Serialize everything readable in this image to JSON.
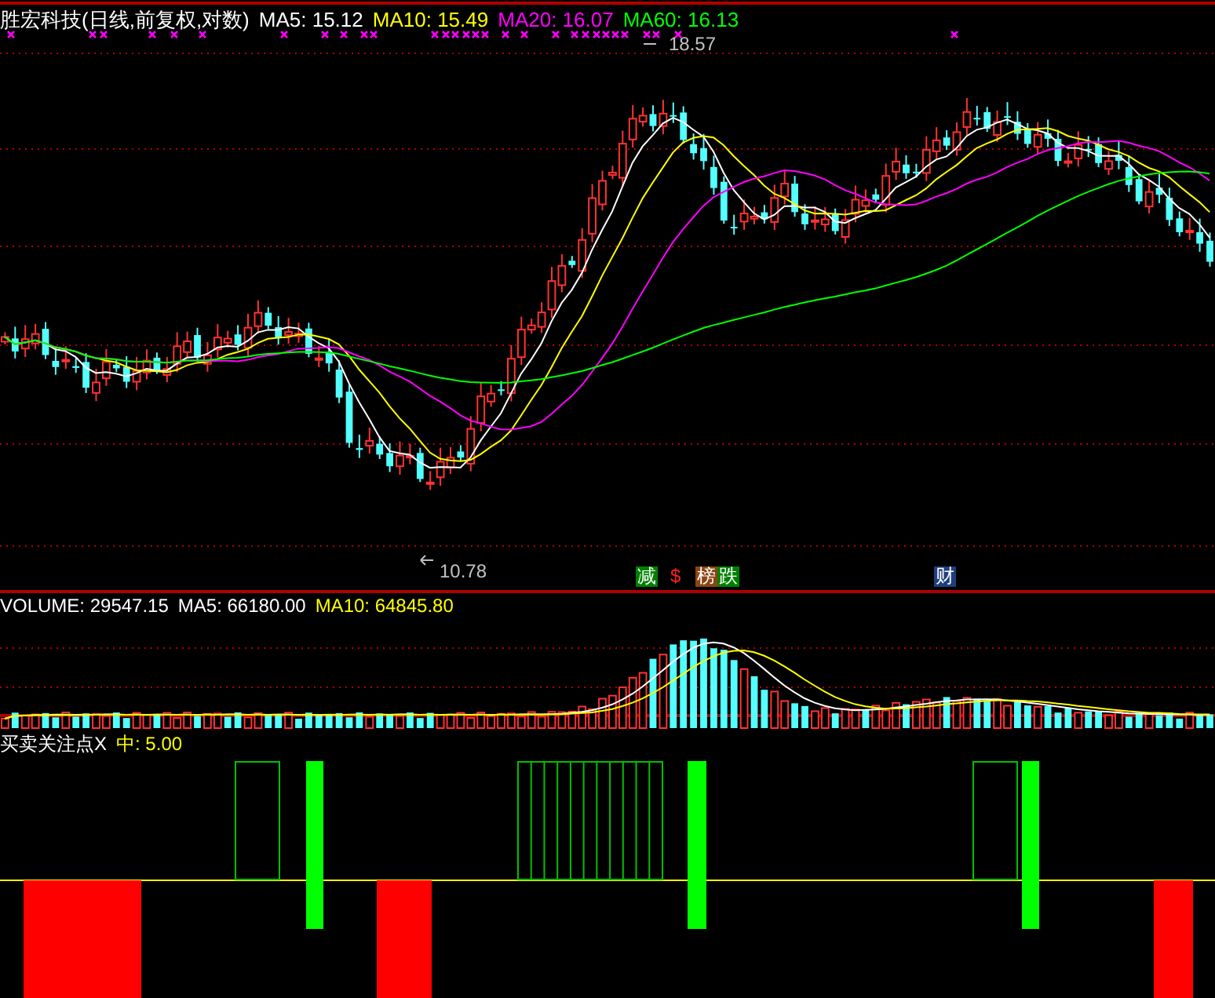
{
  "price_panel": {
    "title": "胜宏科技(日线,前复权,对数)",
    "ma_legend": [
      {
        "label": "MA5: 15.12",
        "color": "#ffffff"
      },
      {
        "label": "MA10: 15.49",
        "color": "#ffff00"
      },
      {
        "label": "MA20: 16.07",
        "color": "#ff00ff"
      },
      {
        "label": "MA60: 16.13",
        "color": "#00ff00"
      }
    ],
    "high_label": "18.57",
    "low_label": "10.78",
    "signal_tags": [
      {
        "text": "减",
        "color": "#008000"
      },
      {
        "text": "$",
        "color": "#000000"
      },
      {
        "text": "榜",
        "color": "#8b4513"
      },
      {
        "text": "跌",
        "color": "#008000"
      },
      {
        "text": "财",
        "color": "#1f3f7f"
      }
    ]
  },
  "volume_panel": {
    "legend": [
      {
        "label": "VOLUME: 29547.15",
        "color": "#ffffff"
      },
      {
        "label": "MA5: 66180.00",
        "color": "#ffffff"
      },
      {
        "label": "MA10: 64845.80",
        "color": "#ffff00"
      }
    ]
  },
  "indicator_panel": {
    "legend": [
      {
        "label": "买卖关注点X",
        "color": "#ffffff"
      },
      {
        "label": "中: 5.00",
        "color": "#ffff00"
      }
    ]
  }
}
